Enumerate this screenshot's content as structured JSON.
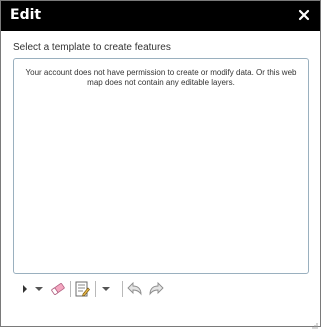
{
  "window": {
    "title": "Edit",
    "close_icon": "close-icon"
  },
  "instruction": "Select a template to create features",
  "message": "Your account does not have permission to create or modify data. Or this web map does not contain any editable layers.",
  "toolbar": {
    "items": [
      "select-tool-icon",
      "select-dropdown-icon",
      "clear-selection-icon",
      "attributes-icon",
      "tools-dropdown-icon",
      "undo-icon",
      "redo-icon"
    ]
  },
  "colors": {
    "titlebar": "#000000",
    "border": "#9ab0bf"
  }
}
